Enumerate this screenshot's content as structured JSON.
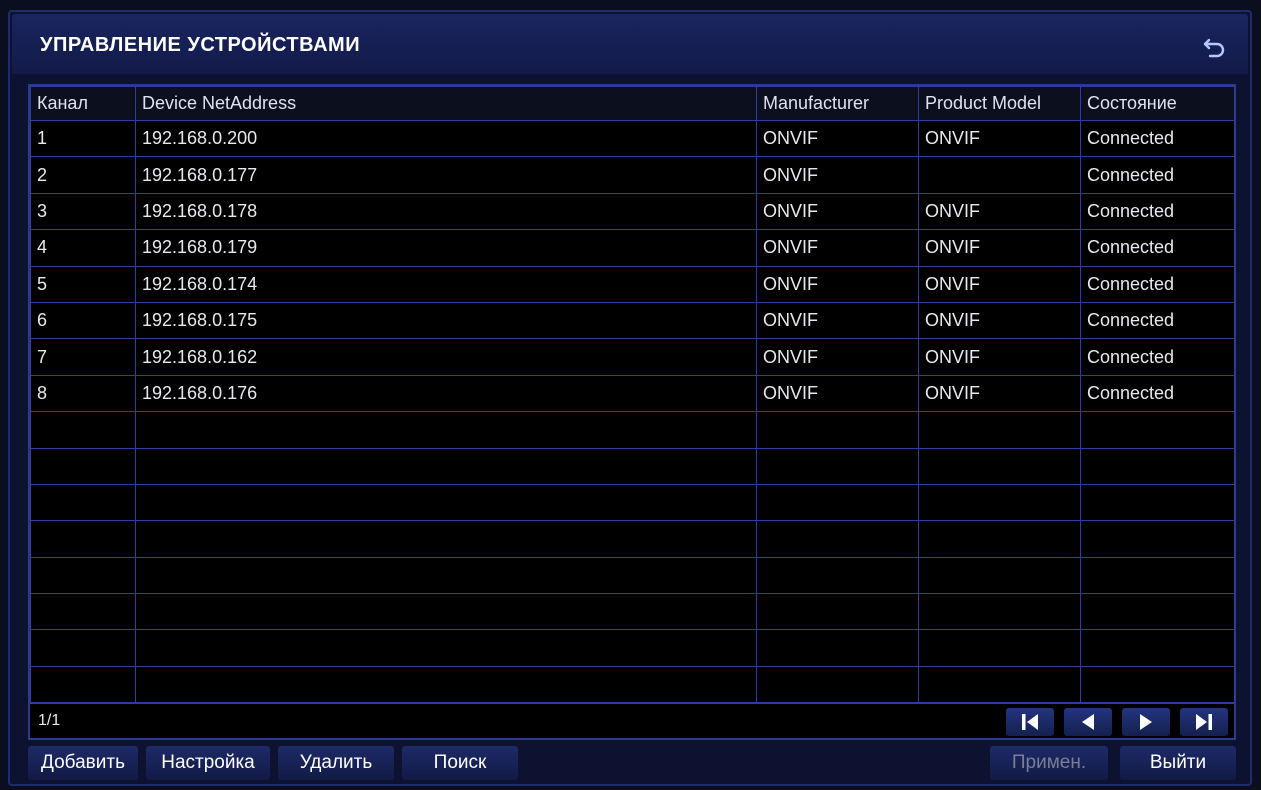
{
  "header": {
    "title": "УПРАВЛЕНИЕ УСТРОЙСТВАМИ"
  },
  "table": {
    "columns": [
      "Канал",
      "Device NetAddress",
      "Manufacturer",
      "Product Model",
      "Состояние"
    ],
    "rows": [
      [
        "1",
        "192.168.0.200",
        "ONVIF",
        "ONVIF",
        "Connected"
      ],
      [
        "2",
        "192.168.0.177",
        "ONVIF",
        "",
        "Connected"
      ],
      [
        "3",
        "192.168.0.178",
        "ONVIF",
        "ONVIF",
        "Connected"
      ],
      [
        "4",
        "192.168.0.179",
        "ONVIF",
        "ONVIF",
        "Connected"
      ],
      [
        "5",
        "192.168.0.174",
        "ONVIF",
        "ONVIF",
        "Connected"
      ],
      [
        "6",
        "192.168.0.175",
        "ONVIF",
        "ONVIF",
        "Connected"
      ],
      [
        "7",
        "192.168.0.162",
        "ONVIF",
        "ONVIF",
        "Connected"
      ],
      [
        "8",
        "192.168.0.176",
        "ONVIF",
        "ONVIF",
        "Connected"
      ],
      [
        "",
        "",
        "",
        "",
        ""
      ],
      [
        "",
        "",
        "",
        "",
        ""
      ],
      [
        "",
        "",
        "",
        "",
        ""
      ],
      [
        "",
        "",
        "",
        "",
        ""
      ],
      [
        "",
        "",
        "",
        "",
        ""
      ],
      [
        "",
        "",
        "",
        "",
        ""
      ],
      [
        "",
        "",
        "",
        "",
        ""
      ],
      [
        "",
        "",
        "",
        "",
        ""
      ]
    ]
  },
  "pager": {
    "page_info": "1/1",
    "buttons": [
      "first-page-icon",
      "prev-page-icon",
      "next-page-icon",
      "last-page-icon"
    ]
  },
  "actions": {
    "add_label": "Добавить",
    "settings_label": "Настройка",
    "delete_label": "Удалить",
    "search_label": "Поиск",
    "apply_label": "Примен.",
    "exit_label": "Выйти"
  },
  "icons": {
    "back": "back-arrow-icon"
  },
  "colors": {
    "background": "#0c1230",
    "grid_line": "#2c3fa0",
    "text": "#e8e8f0",
    "disabled_text": "#7a7f96"
  }
}
